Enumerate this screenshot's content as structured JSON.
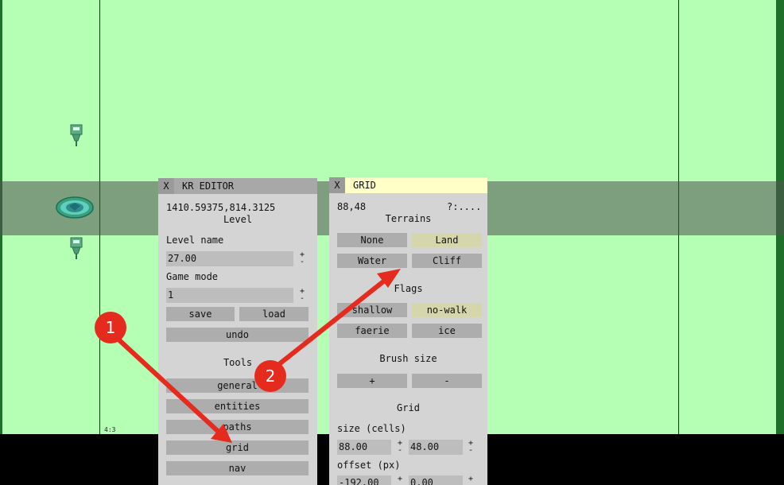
{
  "colors": {
    "grass": "#b5ffb5",
    "panel_bg": "#d4d4d4",
    "button": "#adadad",
    "button_active": "#d6d6ad",
    "grid_title_bg": "#ffffc8",
    "annotation": "#e52b1e"
  },
  "viewport": {
    "aspect_label": "4:3"
  },
  "icons": {
    "tower": "tower-icon",
    "spawn": "spawn-point-icon"
  },
  "editor": {
    "close_label": "X",
    "title": "KR EDITOR",
    "coords": "1410.59375,814.3125",
    "section_label": "Level",
    "level_name_label": "Level name",
    "level_name_value": "27.00",
    "game_mode_label": "Game mode",
    "game_mode_value": "1",
    "plus": "+",
    "minus": "-",
    "save_label": "save",
    "load_label": "load",
    "undo_label": "undo",
    "tools_label": "Tools",
    "tools": [
      "general",
      "entities",
      "paths",
      "grid",
      "nav"
    ]
  },
  "grid_panel": {
    "close_label": "X",
    "title": "GRID",
    "cell_pos": "88,48",
    "cell_info": "?:....",
    "terrains_label": "Terrains",
    "terrains": [
      "None",
      "Land",
      "Water",
      "Cliff"
    ],
    "active_terrain": "Land",
    "flags_label": "Flags",
    "flags": [
      "shallow",
      "no-walk",
      "faerie",
      "ice"
    ],
    "active_flag": "no-walk",
    "brush_label": "Brush size",
    "brush_plus": "+",
    "brush_minus": "-",
    "grid_label": "Grid",
    "size_label": "size (cells)",
    "size_w": "88.00",
    "size_h": "48.00",
    "offset_label": "offset (px)",
    "offset_x": "-192.00",
    "offset_y": "0.00",
    "plus": "+",
    "minus": "-"
  },
  "annotations": {
    "step1": "1",
    "step2": "2"
  }
}
